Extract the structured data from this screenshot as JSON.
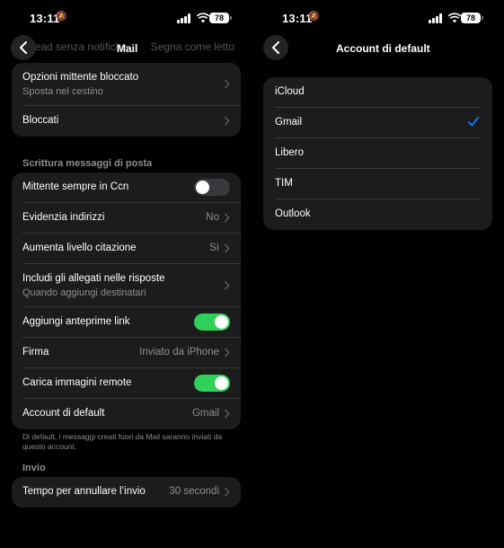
{
  "status": {
    "time": "13:11",
    "battery": "78"
  },
  "left": {
    "ghost_header": "Mail",
    "ghost_row_label": "Read senza notifiche",
    "ghost_row_value": "Segna come letto",
    "nav_title": "Mail",
    "card1": {
      "rows": [
        {
          "label": "Opzioni mittente bloccato",
          "sub": "Sposta nel cestino"
        },
        {
          "label": "Bloccati"
        }
      ]
    },
    "section_compose": "Scrittura messaggi di posta",
    "card2": {
      "rows": [
        {
          "label": "Mittente sempre in Ccn",
          "toggle": false
        },
        {
          "label": "Evidenzia indirizzi",
          "value": "No"
        },
        {
          "label": "Aumenta livello citazione",
          "value": "Sì"
        },
        {
          "label": "Includi gli allegati nelle risposte",
          "sub": "Quando aggiungi destinatari"
        },
        {
          "label": "Aggiungi anteprime link",
          "toggle": true
        },
        {
          "label": "Firma",
          "value": "Inviato da iPhone"
        },
        {
          "label": "Carica immagini remote",
          "toggle": true
        },
        {
          "label": "Account di default",
          "value": "Gmail"
        }
      ]
    },
    "footer_note": "Di default, i messaggi creati fuori da Mail saranno inviati da questo account.",
    "section_send": "Invio",
    "card3": {
      "rows": [
        {
          "label": "Tempo per annullare l’invio",
          "value": "30 secondi"
        }
      ]
    }
  },
  "right": {
    "nav_title": "Account di default",
    "accounts": [
      "iCloud",
      "Gmail",
      "Libero",
      "TIM",
      "Outlook"
    ],
    "selected": "Gmail",
    "accent_color": "#0a84ff"
  }
}
